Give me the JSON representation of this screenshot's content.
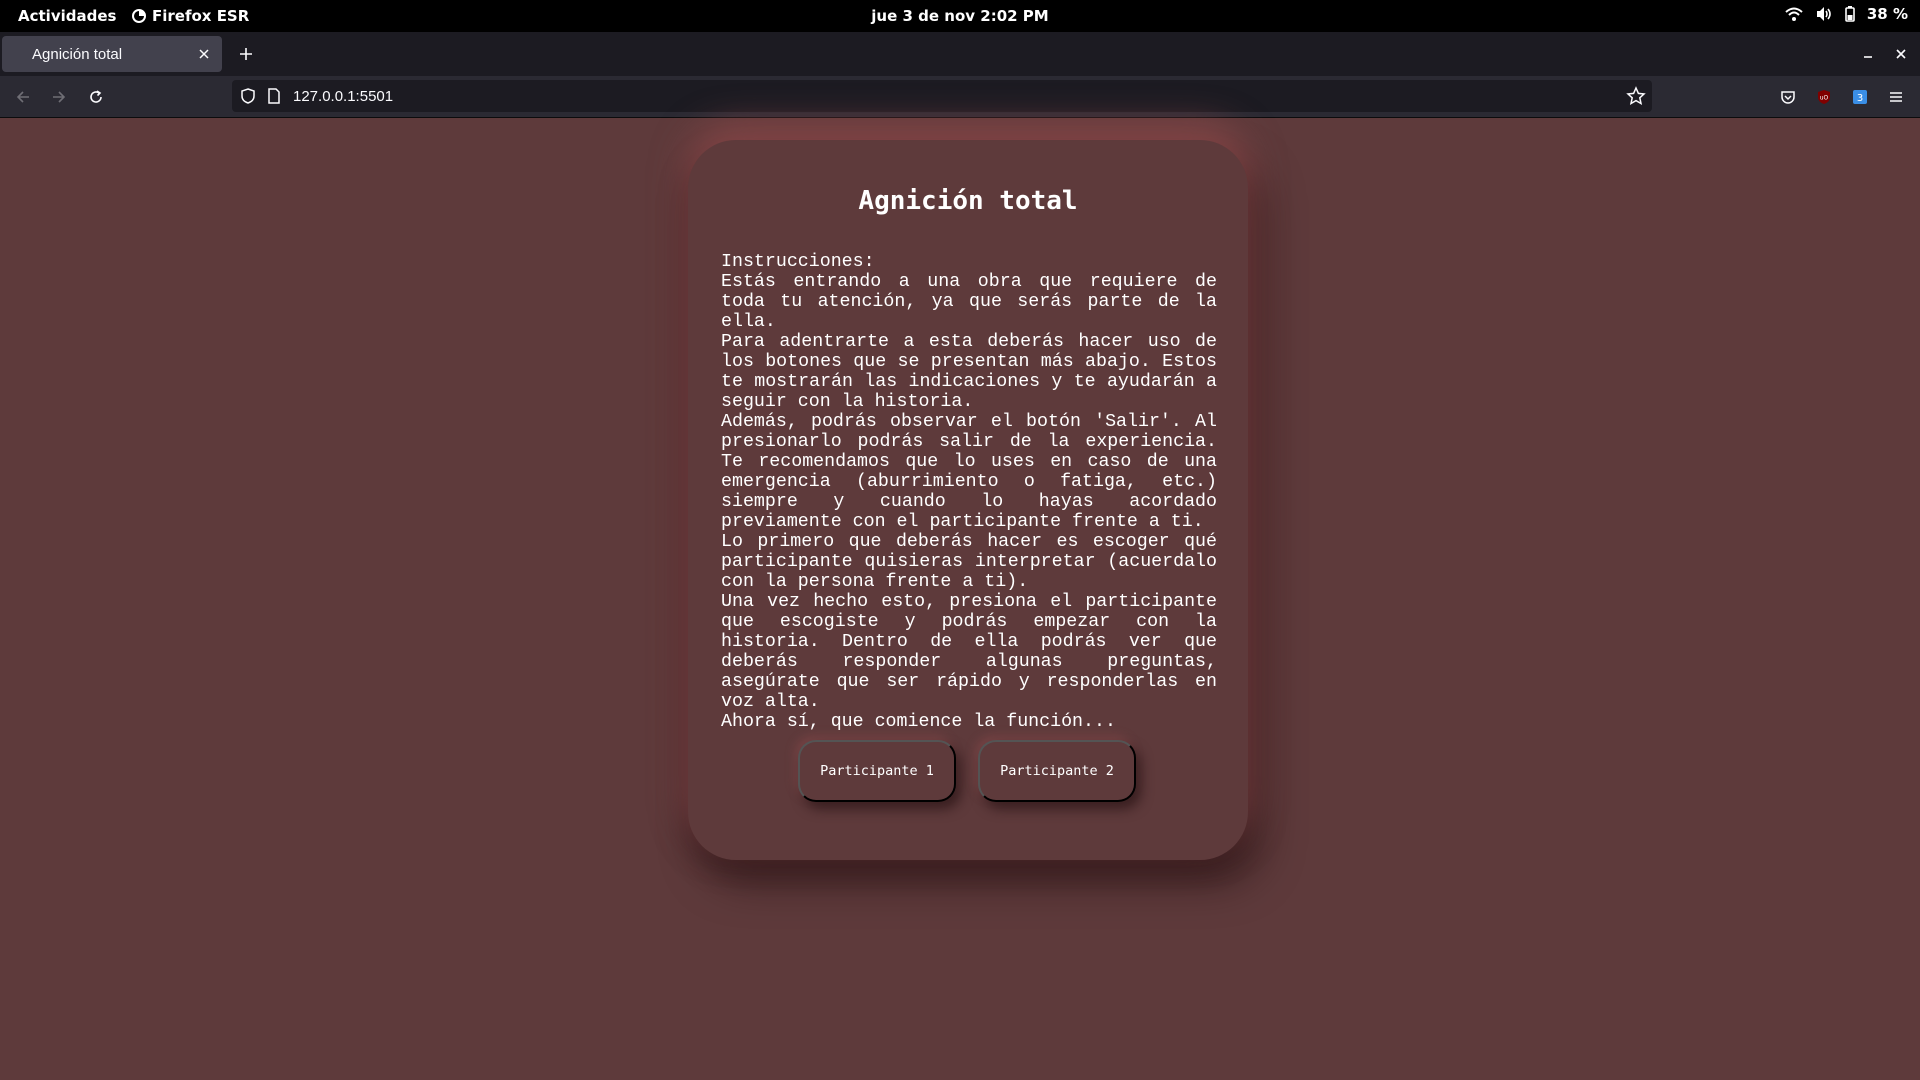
{
  "system_bar": {
    "activities": "Actividades",
    "app_name": "Firefox ESR",
    "clock": "jue  3 de nov  2:02 PM",
    "battery": "38 %"
  },
  "browser": {
    "tab_title": "Agnición total",
    "url": "127.0.0.1:5501",
    "icons": [
      "firefox-icon",
      "wifi-icon",
      "volume-icon",
      "battery-icon",
      "close-icon",
      "plus-icon",
      "minimize-icon",
      "back-icon",
      "forward-icon",
      "reload-icon",
      "shield-icon",
      "page-icon",
      "star-icon",
      "pocket-icon",
      "ublock-icon",
      "extension-icon",
      "menu-icon"
    ]
  },
  "page": {
    "title": "Agnición total",
    "instructions": [
      "Instrucciones:",
      "Estás entrando a una obra que requiere de toda tu atención, ya que serás parte de la ella.",
      "Para adentrarte a esta deberás hacer uso de los botones que se presentan más abajo. Estos te mostrarán las indicaciones y te ayudarán a seguir con la historia.",
      "Además, podrás observar el botón 'Salir'. Al presionarlo podrás salir de la experiencia. Te recomendamos que lo uses en caso de una emergencia (aburrimiento o fatiga, etc.) siempre y cuando lo hayas acordado previamente con el participante frente a ti.",
      "Lo primero que deberás hacer es escoger qué participante quisieras interpretar (acuerdalo con la persona frente a ti).",
      "Una vez hecho esto, presiona el participante que escogiste y podrás empezar con la historia. Dentro de ella podrás ver que deberás responder algunas preguntas, asegúrate que ser rápido y responderlas en voz alta.",
      "Ahora sí, que comience la función..."
    ],
    "buttons": {
      "participant_1": "Participante 1",
      "participant_2": "Participante 2"
    },
    "colors": {
      "background": "#5e3a3b",
      "text": "#ffffff"
    }
  }
}
